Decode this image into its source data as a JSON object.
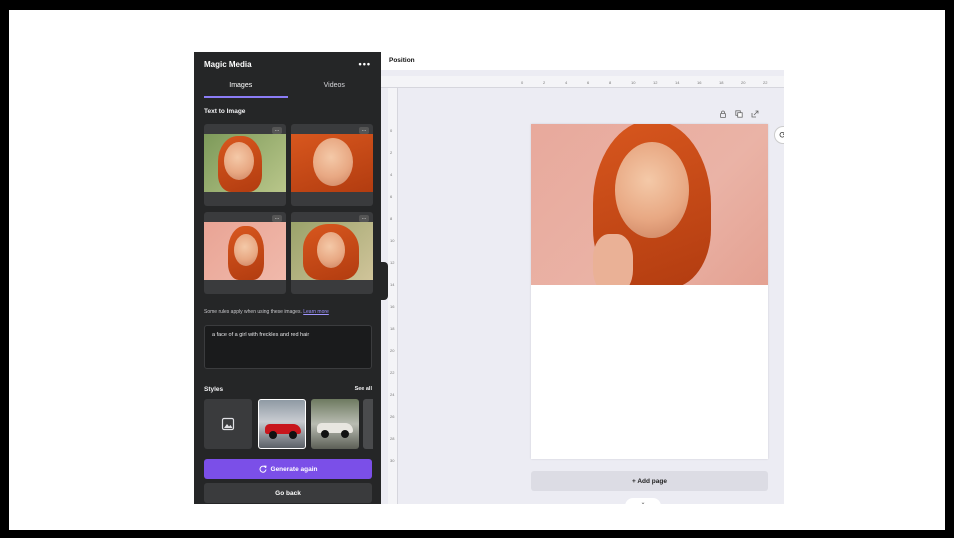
{
  "sidebar": {
    "title": "Magic Media",
    "more_label": "•••",
    "tabs": [
      {
        "label": "Images",
        "active": true
      },
      {
        "label": "Videos",
        "active": false
      }
    ],
    "section_label": "Text to Image",
    "rules_text": "Some rules apply when using these images.",
    "rules_link": "Learn more",
    "prompt_value": "a face of a girl with freckles and red hair",
    "styles_label": "Styles",
    "see_all_label": "See all",
    "generate_label": "Generate again",
    "back_label": "Go back"
  },
  "toolbar": {
    "position_label": "Position"
  },
  "ruler": {
    "h_ticks": [
      "0",
      "2",
      "4",
      "6",
      "8",
      "10",
      "12",
      "14",
      "16",
      "18",
      "20",
      "22"
    ],
    "v_ticks": [
      "0",
      "2",
      "4",
      "6",
      "8",
      "10",
      "12",
      "14",
      "16",
      "18",
      "20",
      "22",
      "24",
      "26",
      "28",
      "30"
    ]
  },
  "canvas": {
    "add_page_label": "+ Add page",
    "page_tools": [
      "lock-icon",
      "duplicate-icon",
      "add-page-icon"
    ]
  },
  "colors": {
    "accent": "#7b4fe8",
    "sidebar_bg": "#252627",
    "hair": "#d8571e"
  }
}
